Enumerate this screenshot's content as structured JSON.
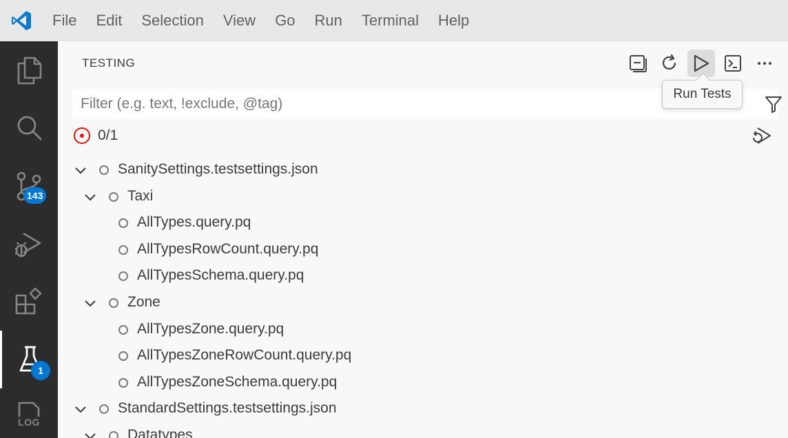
{
  "menu": [
    "File",
    "Edit",
    "Selection",
    "View",
    "Go",
    "Run",
    "Terminal",
    "Help"
  ],
  "activity": {
    "scm_badge": "143",
    "testing_badge": "1",
    "log_label": "LOG"
  },
  "panel": {
    "title": "TESTING",
    "tooltip": "Run Tests",
    "filter_placeholder": "Filter (e.g. text, !exclude, @tag)",
    "summary_count": "0/1"
  },
  "tree": [
    {
      "label": "SanitySettings.testsettings.json",
      "level": 0,
      "expandable": true
    },
    {
      "label": "Taxi",
      "level": 1,
      "expandable": true
    },
    {
      "label": "AllTypes.query.pq",
      "level": 2,
      "expandable": false
    },
    {
      "label": "AllTypesRowCount.query.pq",
      "level": 2,
      "expandable": false
    },
    {
      "label": "AllTypesSchema.query.pq",
      "level": 2,
      "expandable": false
    },
    {
      "label": "Zone",
      "level": 1,
      "expandable": true
    },
    {
      "label": "AllTypesZone.query.pq",
      "level": 2,
      "expandable": false
    },
    {
      "label": "AllTypesZoneRowCount.query.pq",
      "level": 2,
      "expandable": false
    },
    {
      "label": "AllTypesZoneSchema.query.pq",
      "level": 2,
      "expandable": false
    },
    {
      "label": "StandardSettings.testsettings.json",
      "level": 0,
      "expandable": true
    },
    {
      "label": "Datatypes",
      "level": 1,
      "expandable": true
    }
  ],
  "colors": {
    "accent": "#0078d4",
    "activitybar": "#2c2c2c",
    "error": "#e51400"
  }
}
